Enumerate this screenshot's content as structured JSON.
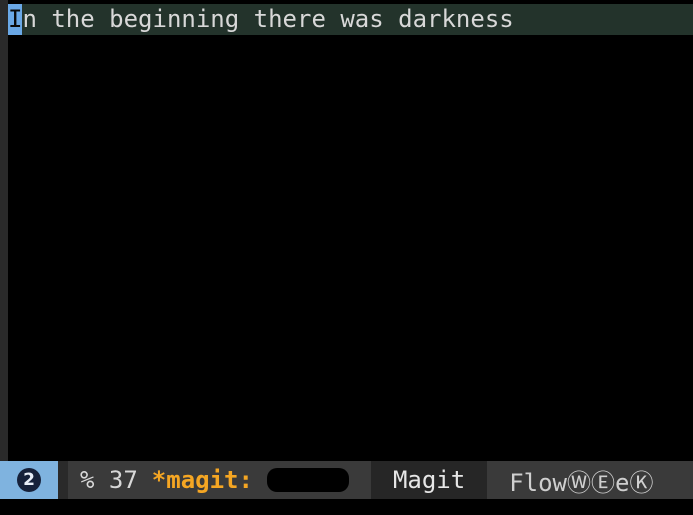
{
  "buffer": {
    "cursor_char": "I",
    "line_rest": "n the beginning there was darkness"
  },
  "modeline": {
    "window_number": "2",
    "percent": "% 37",
    "buffer_name": "*magit:",
    "major_mode": "Magit",
    "minor_modes": "FlowⓌⒺeⓀ"
  },
  "colors": {
    "window_segment": "#7fb3df",
    "buffer_name": "#f5a623",
    "current_line": "#23332b",
    "cursor": "#6aa8e6"
  }
}
